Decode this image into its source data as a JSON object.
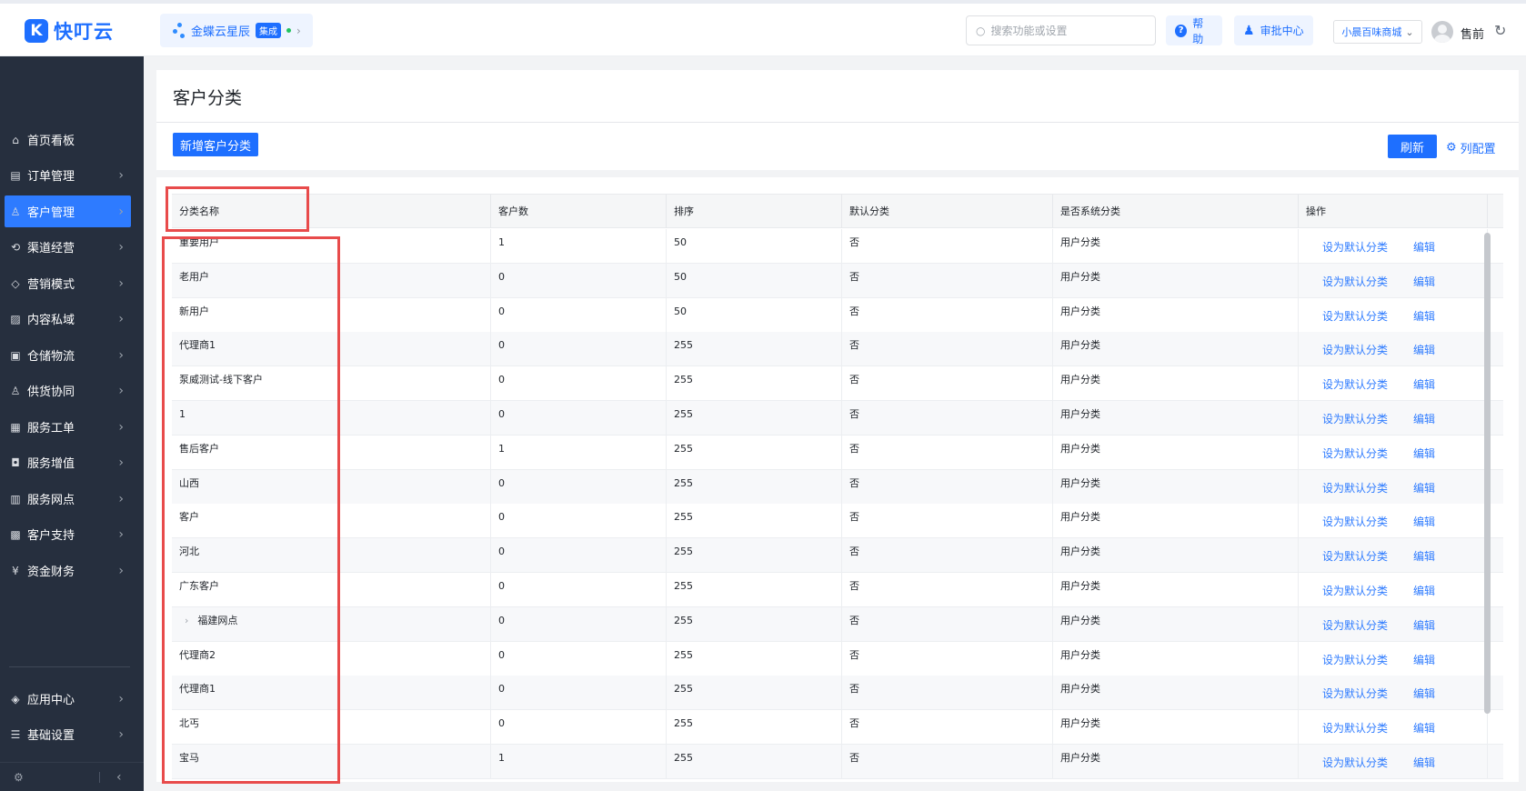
{
  "header": {
    "logo_text": "快叮云",
    "logo_mark": "K",
    "product_name": "金蝶云星辰",
    "product_badge": "集成",
    "search_placeholder": "搜索功能或设置",
    "help_label": "帮助",
    "approval_label": "审批中心",
    "store_name": "小晨百味商城",
    "user_name": "售前"
  },
  "sidebar": {
    "items": [
      {
        "label": "首页看板",
        "icon": "home-icon",
        "glyph": "⌂",
        "active": false,
        "has_arrow": false
      },
      {
        "label": "订单管理",
        "icon": "order-icon",
        "glyph": "▤",
        "active": false,
        "has_arrow": true
      },
      {
        "label": "客户管理",
        "icon": "user-icon",
        "glyph": "♙",
        "active": true,
        "has_arrow": true
      },
      {
        "label": "渠道经营",
        "icon": "channel-icon",
        "glyph": "⟲",
        "active": false,
        "has_arrow": true
      },
      {
        "label": "营销模式",
        "icon": "tag-icon",
        "glyph": "◇",
        "active": false,
        "has_arrow": true
      },
      {
        "label": "内容私域",
        "icon": "image-icon",
        "glyph": "▨",
        "active": false,
        "has_arrow": true
      },
      {
        "label": "仓储物流",
        "icon": "warehouse-icon",
        "glyph": "▣",
        "active": false,
        "has_arrow": true
      },
      {
        "label": "供货协同",
        "icon": "supply-icon",
        "glyph": "♙",
        "active": false,
        "has_arrow": true
      },
      {
        "label": "服务工单",
        "icon": "ticket-icon",
        "glyph": "▦",
        "active": false,
        "has_arrow": true
      },
      {
        "label": "服务增值",
        "icon": "bag-icon",
        "glyph": "◘",
        "active": false,
        "has_arrow": true
      },
      {
        "label": "服务网点",
        "icon": "store-icon",
        "glyph": "▥",
        "active": false,
        "has_arrow": true
      },
      {
        "label": "客户支持",
        "icon": "support-icon",
        "glyph": "▩",
        "active": false,
        "has_arrow": true
      },
      {
        "label": "资金财务",
        "icon": "finance-icon",
        "glyph": "¥",
        "active": false,
        "has_arrow": true
      }
    ],
    "bottom_items": [
      {
        "label": "应用中心",
        "icon": "cube-icon",
        "glyph": "◈"
      },
      {
        "label": "基础设置",
        "icon": "menu-icon",
        "glyph": "☰"
      }
    ]
  },
  "page": {
    "title": "客户分类",
    "add_button": "新增客户分类",
    "refresh_button": "刷新",
    "column_config": "列配置"
  },
  "table": {
    "columns": [
      "分类名称",
      "客户数",
      "排序",
      "默认分类",
      "是否系统分类",
      "操作"
    ],
    "actions": [
      "设为默认分类",
      "编辑"
    ],
    "rows": [
      {
        "name": "重要用户",
        "count": "1",
        "sort": "50",
        "default": "否",
        "system": "用户分类",
        "expandable": false
      },
      {
        "name": "老用户",
        "count": "0",
        "sort": "50",
        "default": "否",
        "system": "用户分类",
        "expandable": false
      },
      {
        "name": "新用户",
        "count": "0",
        "sort": "50",
        "default": "否",
        "system": "用户分类",
        "expandable": false
      },
      {
        "name": "代理商1",
        "count": "0",
        "sort": "255",
        "default": "否",
        "system": "用户分类",
        "expandable": false
      },
      {
        "name": "泵威测试-线下客户",
        "count": "0",
        "sort": "255",
        "default": "否",
        "system": "用户分类",
        "expandable": false
      },
      {
        "name": "1",
        "count": "0",
        "sort": "255",
        "default": "否",
        "system": "用户分类",
        "expandable": false
      },
      {
        "name": "售后客户",
        "count": "1",
        "sort": "255",
        "default": "否",
        "system": "用户分类",
        "expandable": false
      },
      {
        "name": "山西",
        "count": "0",
        "sort": "255",
        "default": "否",
        "system": "用户分类",
        "expandable": false
      },
      {
        "name": "客户",
        "count": "0",
        "sort": "255",
        "default": "否",
        "system": "用户分类",
        "expandable": false
      },
      {
        "name": "河北",
        "count": "0",
        "sort": "255",
        "default": "否",
        "system": "用户分类",
        "expandable": false
      },
      {
        "name": "广东客户",
        "count": "0",
        "sort": "255",
        "default": "否",
        "system": "用户分类",
        "expandable": false
      },
      {
        "name": "福建网点",
        "count": "0",
        "sort": "255",
        "default": "否",
        "system": "用户分类",
        "expandable": true
      },
      {
        "name": "代理商2",
        "count": "0",
        "sort": "255",
        "default": "否",
        "system": "用户分类",
        "expandable": false
      },
      {
        "name": "代理商1",
        "count": "0",
        "sort": "255",
        "default": "否",
        "system": "用户分类",
        "expandable": false
      },
      {
        "name": "北丐",
        "count": "0",
        "sort": "255",
        "default": "否",
        "system": "用户分类",
        "expandable": false
      },
      {
        "name": "宝马",
        "count": "1",
        "sort": "255",
        "default": "否",
        "system": "用户分类",
        "expandable": false
      }
    ]
  },
  "colors": {
    "accent": "#1e6fff",
    "sidebar_bg": "#262f3e",
    "highlight_box": "#e84b4b"
  }
}
